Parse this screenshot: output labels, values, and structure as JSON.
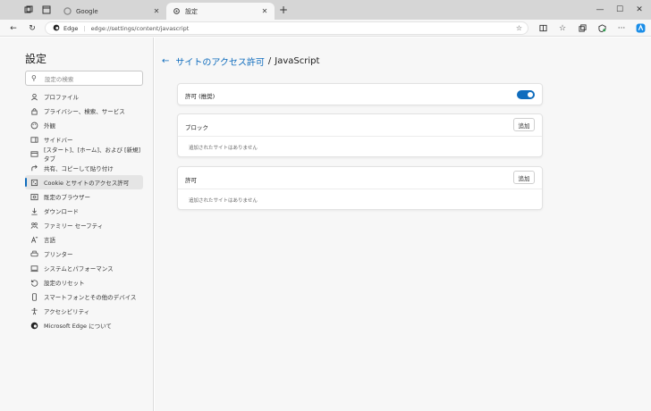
{
  "browser": {
    "tabs": [
      {
        "title": "Google",
        "active": false
      },
      {
        "title": "設定",
        "active": true
      }
    ],
    "address": {
      "site_label": "Edge",
      "url": "edge://settings/content/javascript"
    }
  },
  "sidebar": {
    "title": "設定",
    "search_placeholder": "設定の検索",
    "items": [
      {
        "label": "プロファイル",
        "icon": "profile-icon"
      },
      {
        "label": "プライバシー、検索、サービス",
        "icon": "lock-icon"
      },
      {
        "label": "外観",
        "icon": "appearance-icon"
      },
      {
        "label": "サイドバー",
        "icon": "sidebar-icon"
      },
      {
        "label": "[スタート]、[ホーム]、および [新規] タブ",
        "icon": "home-icon"
      },
      {
        "label": "共有、コピーして貼り付け",
        "icon": "share-icon"
      },
      {
        "label": "Cookie とサイトのアクセス許可",
        "icon": "cookie-icon",
        "active": true
      },
      {
        "label": "既定のブラウザー",
        "icon": "browser-icon"
      },
      {
        "label": "ダウンロード",
        "icon": "download-icon"
      },
      {
        "label": "ファミリー セーフティ",
        "icon": "family-icon"
      },
      {
        "label": "言語",
        "icon": "language-icon"
      },
      {
        "label": "プリンター",
        "icon": "printer-icon"
      },
      {
        "label": "システムとパフォーマンス",
        "icon": "system-icon"
      },
      {
        "label": "設定のリセット",
        "icon": "reset-icon"
      },
      {
        "label": "スマートフォンとその他のデバイス",
        "icon": "phone-icon"
      },
      {
        "label": "アクセシビリティ",
        "icon": "accessibility-icon"
      },
      {
        "label": "Microsoft Edge について",
        "icon": "edge-icon"
      }
    ]
  },
  "main": {
    "breadcrumb_parent": "サイトのアクセス許可",
    "breadcrumb_separator": "/",
    "breadcrumb_current": "JavaScript",
    "allow_recommended": {
      "label": "許可 (推奨)",
      "enabled": true
    },
    "block": {
      "label": "ブロック",
      "add_label": "追加",
      "empty_text": "追加されたサイトはありません"
    },
    "allow": {
      "label": "許可",
      "add_label": "追加",
      "empty_text": "追加されたサイトはありません"
    }
  },
  "colors": {
    "accent": "#0f6cbd"
  }
}
